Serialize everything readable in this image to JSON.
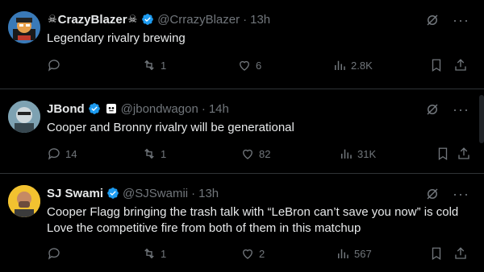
{
  "tweets": [
    {
      "name": "CrazyBlazer",
      "name_prefix": "☠",
      "name_suffix": "☠",
      "handle": "@CrrazyBlazer",
      "time": "13h",
      "text": "Legendary rivalry brewing",
      "replies": "",
      "retweets": "1",
      "likes": "6",
      "views": "2.8K",
      "avatar_bg": "#1d9bf0"
    },
    {
      "name": "JBond",
      "handle": "@jbondwagon",
      "time": "14h",
      "text": "Cooper and Bronny rivalry will be generational",
      "replies": "14",
      "retweets": "1",
      "likes": "82",
      "views": "31K",
      "avatar_bg": "#6a8d9e"
    },
    {
      "name": "SJ Swami",
      "handle": "@SJSwamii",
      "time": "13h",
      "text": "Cooper Flagg bringing the trash talk with “LeBron can’t save you now” is cold Love the competitive fire from both of them in this matchup",
      "replies": "",
      "retweets": "1",
      "likes": "2",
      "views": "567",
      "avatar_bg": "#f2c230"
    }
  ],
  "colors": {
    "background": "#000000",
    "text": "#e7e9ea",
    "muted": "#71767b",
    "verified": "#1d9bf0",
    "divider": "#2f3336"
  }
}
